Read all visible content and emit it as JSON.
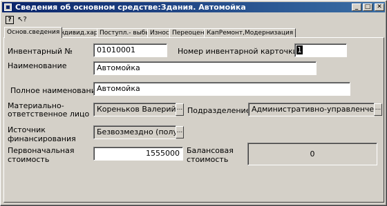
{
  "window": {
    "title": "Сведения об основном средстве:Здания. Автомойка",
    "min_label": "_",
    "max_label": "□",
    "close_label": "✕"
  },
  "toolbar": {
    "help_glyph": "?",
    "whatsthis_glyph": "↖?"
  },
  "tabs": [
    {
      "label": "Основ.сведения"
    },
    {
      "label": "Индивид.хар-ки"
    },
    {
      "label": "Поступл.- выбытие"
    },
    {
      "label": "Износ"
    },
    {
      "label": "Переоценка"
    },
    {
      "label": "КапРемонт,Модернизация"
    }
  ],
  "form": {
    "inventory_label": "Инвентарный №",
    "inventory_value": "01010001",
    "card_label": "Номер инвентарной карточки",
    "card_value": "1",
    "name_label": "Наименование",
    "name_value": "Автомойка",
    "fullname_label": "Полное наименование",
    "fullname_value": "Автомойка",
    "responsible_label_1": "Материально-",
    "responsible_label_2": "ответственное лицо",
    "responsible_value": "Кореньков Валерий Ива",
    "division_label": "Подразделение",
    "division_value": "Административно-управленческий",
    "source_label_1": "Источник",
    "source_label_2": "финансирования",
    "source_value": "Безвозмездно (получе",
    "initial_cost_label_1": "Первоначальная",
    "initial_cost_label_2": "стоимость",
    "initial_cost_value": "1555000",
    "balance_cost_label_1": "Балансовая",
    "balance_cost_label_2": "стоимость",
    "balance_cost_value": "0",
    "ellipsis": "..."
  }
}
